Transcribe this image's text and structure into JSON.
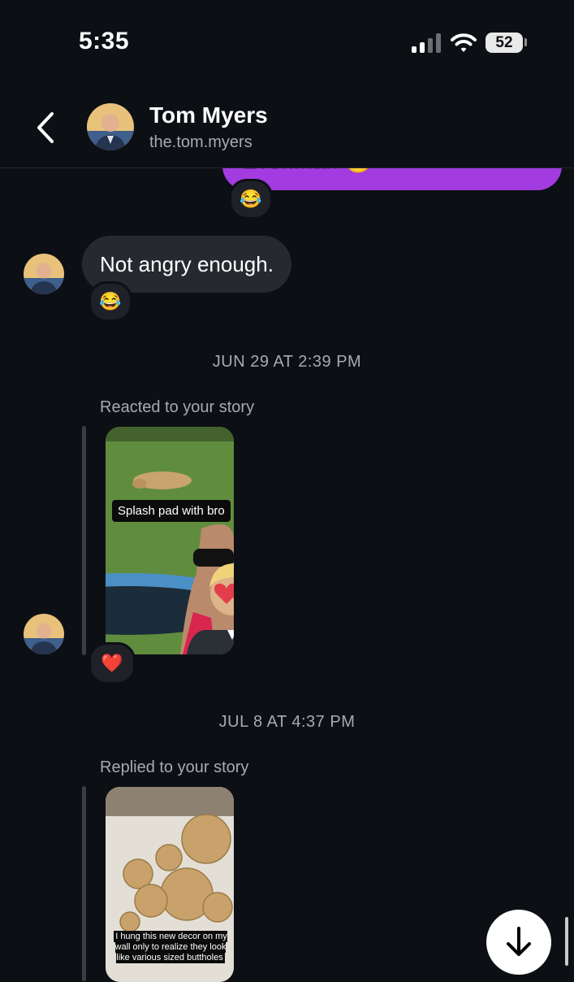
{
  "status_bar": {
    "time": "5:35",
    "battery": "52"
  },
  "header": {
    "name": "Tom Myers",
    "handle": "the.tom.myers"
  },
  "messages": {
    "sent_partial_text": "Evenman 😊",
    "sent_reaction": "😂",
    "received_text": "Not angry enough.",
    "received_reaction": "😂"
  },
  "story_reaction": {
    "timestamp": "JUN 29 AT 2:39 PM",
    "label": "Reacted to your story",
    "caption": "Splash pad with bro",
    "reaction": "❤️"
  },
  "story_reply": {
    "timestamp": "JUL 8 AT 4:37 PM",
    "label": "Replied to your story",
    "caption": "I hung this new decor on my wall only to realize they look like various sized buttholes"
  }
}
